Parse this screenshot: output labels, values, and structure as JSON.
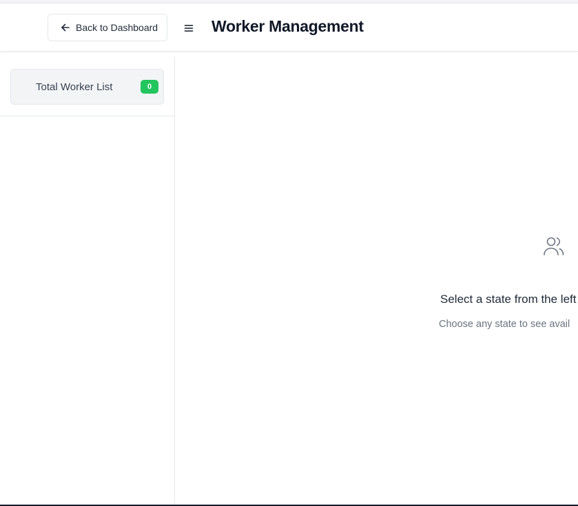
{
  "header": {
    "back_label": "Back to Dashboard",
    "back_icon": "arrow-left-icon",
    "menu_icon": "hamburger-menu-icon",
    "title": "Worker Management"
  },
  "sidebar": {
    "items": [
      {
        "label": "Total Worker List",
        "count": "0",
        "badge_color": "#22c55e"
      }
    ]
  },
  "main": {
    "empty_state": {
      "icon": "users-icon",
      "title": "Select a state from the left",
      "subtitle": "Choose any state to see avail"
    }
  }
}
